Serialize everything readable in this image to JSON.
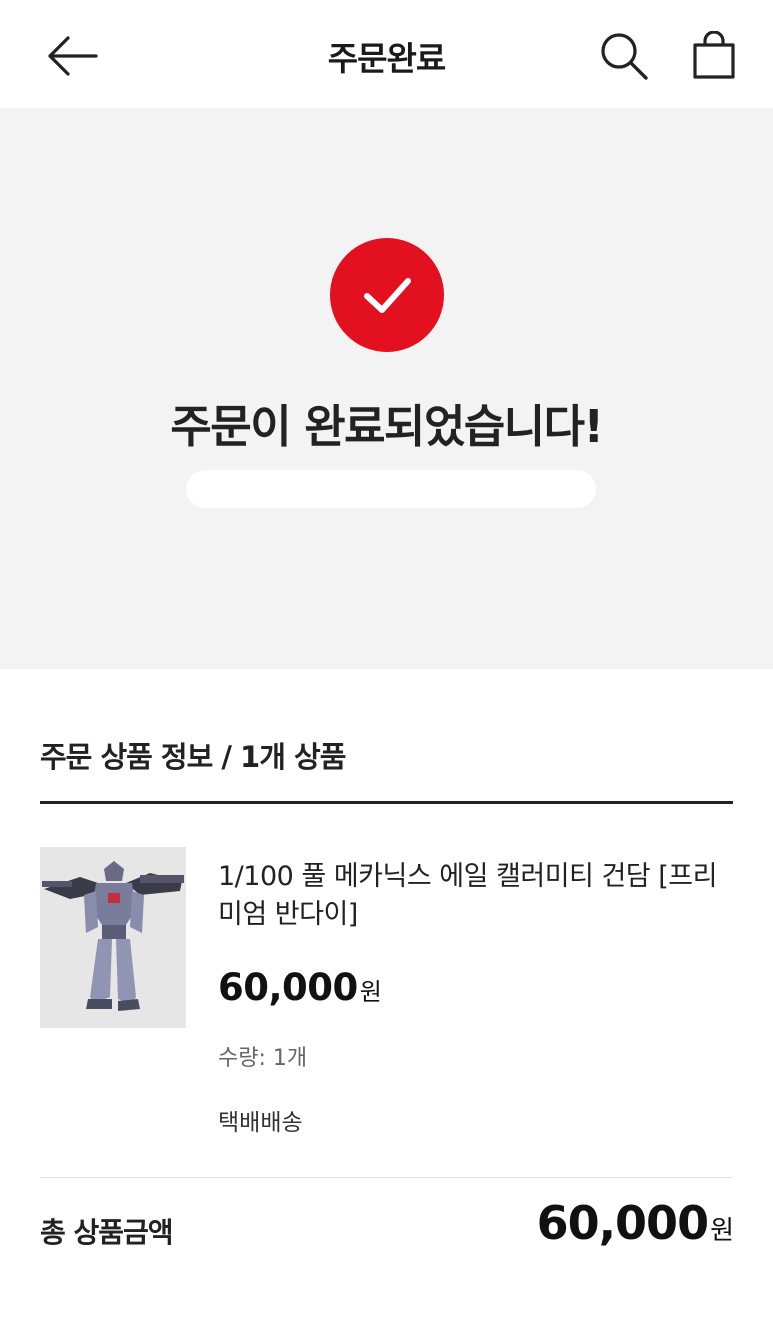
{
  "header": {
    "title": "주문완료",
    "back_icon": "arrow-left-icon",
    "search_icon": "search-icon",
    "cart_icon": "shopping-bag-icon"
  },
  "hero": {
    "check_icon": "check-circle-icon",
    "title": "주문이 완료되었습니다!",
    "accent_color": "#e3101f"
  },
  "order_info": {
    "section_title": "주문 상품 정보 / 1개 상품",
    "product": {
      "name": "1/100 풀 메카닉스 에일 캘러미티 건담 [프리미엄 반다이]",
      "price": "60,000",
      "currency": "원",
      "quantity": "수량: 1개",
      "delivery": "택배배송"
    }
  },
  "total": {
    "label": "총 상품금액",
    "amount": "60,000",
    "currency": "원"
  }
}
